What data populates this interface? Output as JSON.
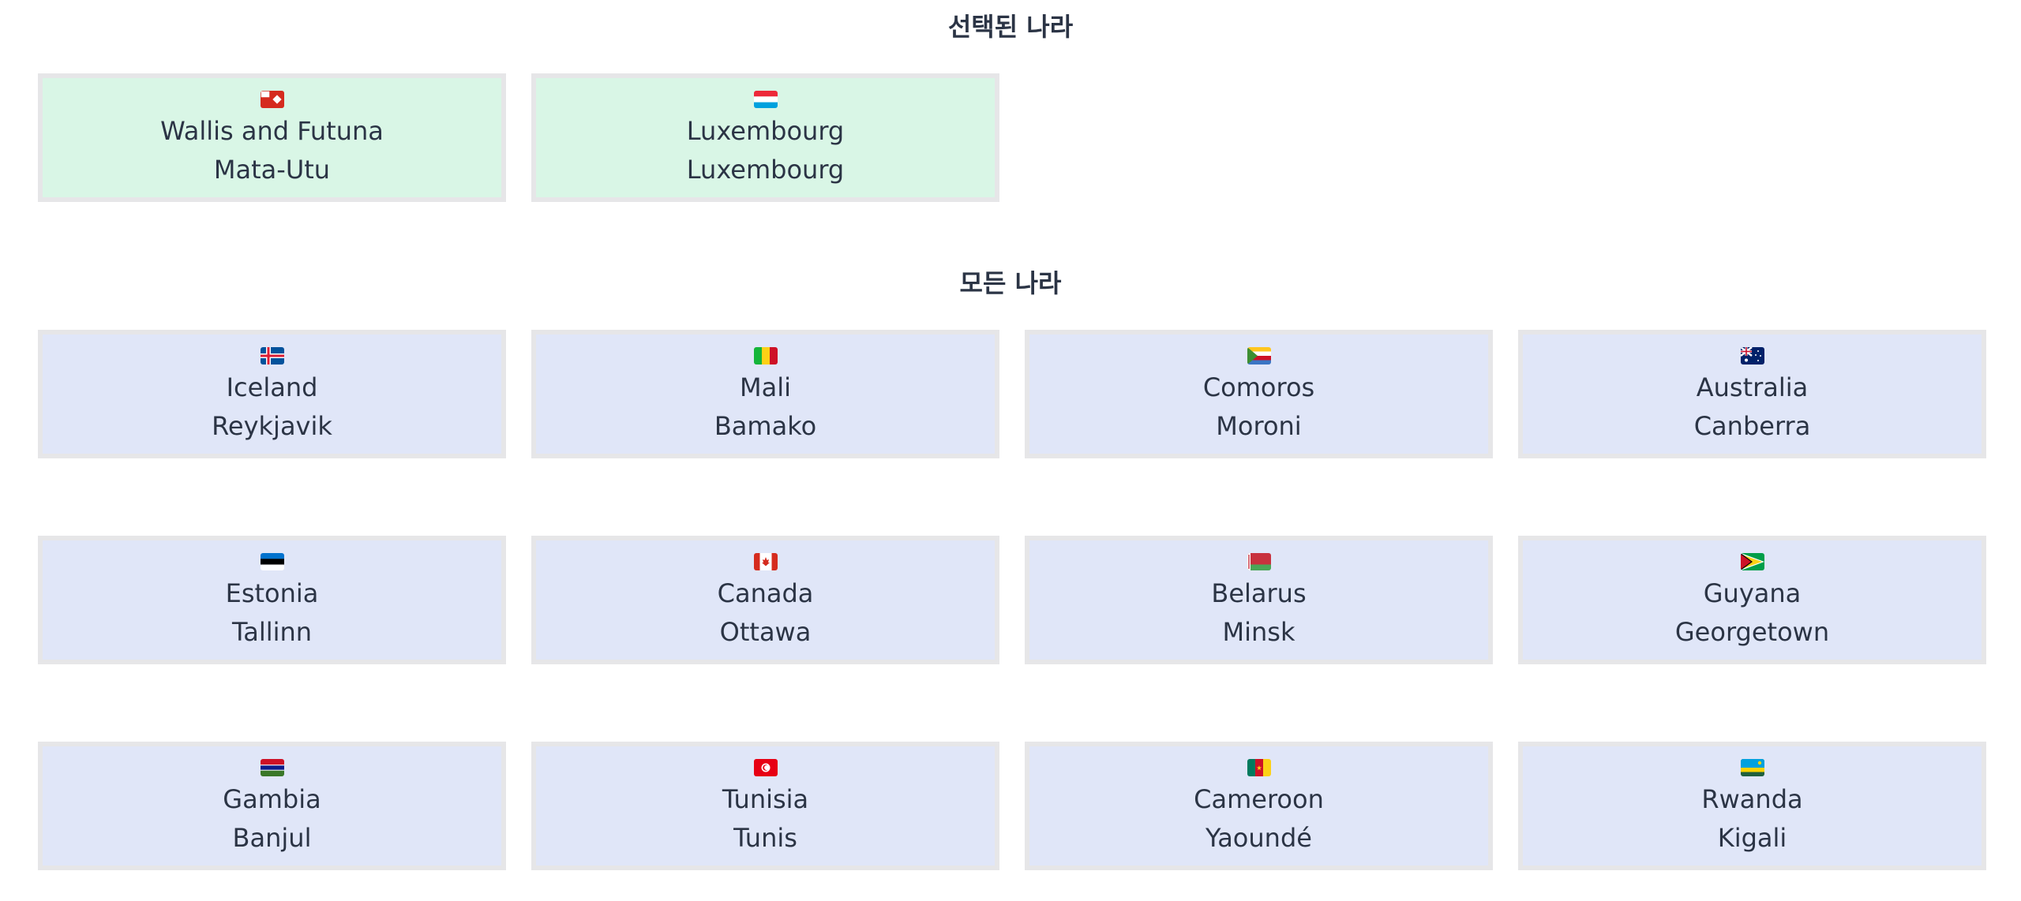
{
  "selected_section": {
    "title": "선택된 나라",
    "countries": [
      {
        "name": "Wallis and Futuna",
        "capital": "Mata-Utu",
        "flag_icon": "wallis-futuna-flag-icon"
      },
      {
        "name": "Luxembourg",
        "capital": "Luxembourg",
        "flag_icon": "luxembourg-flag-icon"
      }
    ]
  },
  "all_section": {
    "title": "모든 나라",
    "countries": [
      {
        "name": "Iceland",
        "capital": "Reykjavik",
        "flag_icon": "iceland-flag-icon"
      },
      {
        "name": "Mali",
        "capital": "Bamako",
        "flag_icon": "mali-flag-icon"
      },
      {
        "name": "Comoros",
        "capital": "Moroni",
        "flag_icon": "comoros-flag-icon"
      },
      {
        "name": "Australia",
        "capital": "Canberra",
        "flag_icon": "australia-flag-icon"
      },
      {
        "name": "Estonia",
        "capital": "Tallinn",
        "flag_icon": "estonia-flag-icon"
      },
      {
        "name": "Canada",
        "capital": "Ottawa",
        "flag_icon": "canada-flag-icon"
      },
      {
        "name": "Belarus",
        "capital": "Minsk",
        "flag_icon": "belarus-flag-icon"
      },
      {
        "name": "Guyana",
        "capital": "Georgetown",
        "flag_icon": "guyana-flag-icon"
      },
      {
        "name": "Gambia",
        "capital": "Banjul",
        "flag_icon": "gambia-flag-icon"
      },
      {
        "name": "Tunisia",
        "capital": "Tunis",
        "flag_icon": "tunisia-flag-icon"
      },
      {
        "name": "Cameroon",
        "capital": "Yaoundé",
        "flag_icon": "cameroon-flag-icon"
      },
      {
        "name": "Rwanda",
        "capital": "Kigali",
        "flag_icon": "rwanda-flag-icon"
      }
    ]
  },
  "colors": {
    "selected_card_bg": "#d9f6e6",
    "card_bg": "#e0e6f8",
    "card_border": "#e6e6e8",
    "text": "#2b3445"
  }
}
